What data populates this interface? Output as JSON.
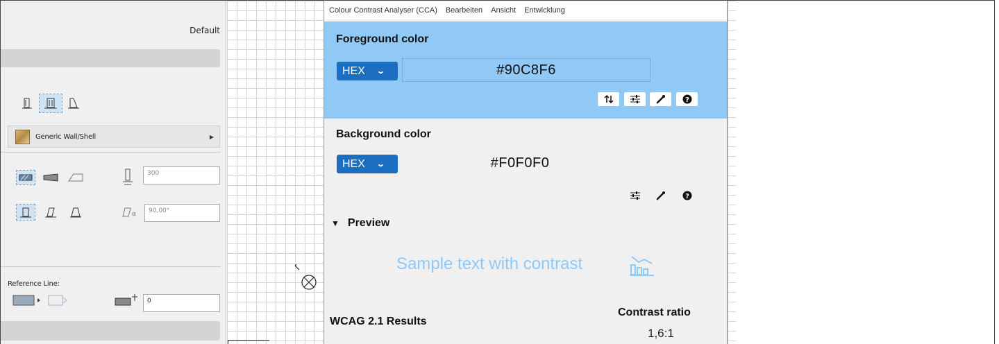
{
  "archicad": {
    "default_label": "Default",
    "material_label": "Generic Wall/Shell",
    "height_value": "300",
    "angle_value": "90,00°",
    "reference_line_label": "Reference Line:",
    "offset_value": "0"
  },
  "cca": {
    "menu": [
      "Colour Contrast Analyser (CCA)",
      "Bearbeiten",
      "Ansicht",
      "Entwicklung"
    ],
    "foreground": {
      "title": "Foreground color",
      "format": "HEX",
      "value": "#90C8F6"
    },
    "background": {
      "title": "Background color",
      "format": "HEX",
      "value": "#F0F0F0"
    },
    "preview": {
      "title": "Preview",
      "sample_text": "Sample text with contrast"
    },
    "results": {
      "title": "WCAG 2.1 Results",
      "contrast_label": "Contrast ratio",
      "contrast_value": "1,6:1"
    }
  },
  "colors": {
    "foreground": "#90C8F6",
    "background": "#F0F0F0",
    "select_blue": "#1C6FC0"
  }
}
